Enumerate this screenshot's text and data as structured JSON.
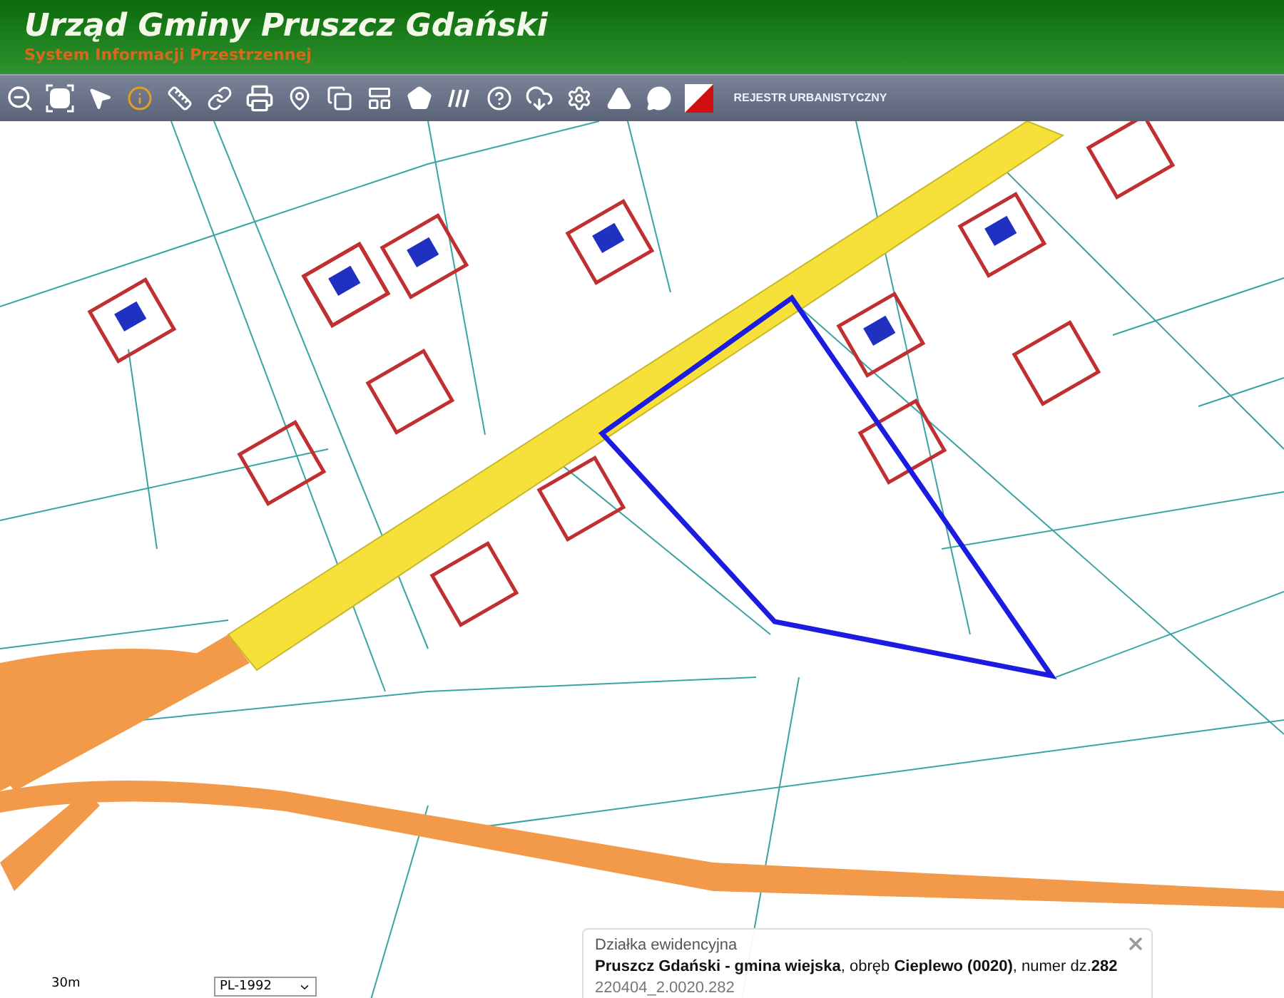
{
  "header": {
    "title": "Urząd Gminy Pruszcz Gdański",
    "subtitle": "System Informacji Przestrzennej"
  },
  "toolbar": {
    "register_button": "REJESTR URBANISTYCZNY"
  },
  "map": {
    "scale_label": "30m",
    "projection_select": "PL-1992"
  },
  "info_popup": {
    "heading": "Działka ewidencyjna",
    "description": "**Pruszcz Gdański - gmina wiejska**, obręb **Cieplewo (0020)**, numer dz.**282**",
    "identifier": "220404_2.0020.282"
  }
}
